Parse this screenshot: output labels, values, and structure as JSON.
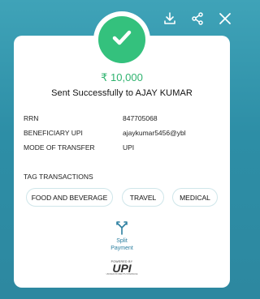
{
  "toolbar": {
    "download_icon": "download-icon",
    "share_icon": "share-icon",
    "close_icon": "close-icon"
  },
  "status": {
    "icon": "check-icon",
    "amount": "₹ 10,000",
    "message": "Sent Successfully to  AJAY KUMAR"
  },
  "details": [
    {
      "label": "RRN",
      "value": "847705068"
    },
    {
      "label": "BENEFICIARY UPI",
      "value": "ajaykumar5456@ybl"
    },
    {
      "label": "MODE OF TRANSFER",
      "value": "UPI"
    }
  ],
  "tags": {
    "title": "TAG TRANSACTIONS",
    "items": [
      "FOOD AND BEVERAGE",
      "TRAVEL",
      "MEDICAL"
    ]
  },
  "split": {
    "icon": "split-arrow-icon",
    "label_line1": "Split",
    "label_line2": "Payment"
  },
  "footer": {
    "powered_by": "POWERED BY",
    "logo": "UPI",
    "tagline": "UNIFIED PAYMENTS INTERFACE"
  },
  "colors": {
    "background": "#3fa3b8",
    "success": "#34c17d",
    "amount": "#2fb36f",
    "accent": "#2c7fa0"
  }
}
